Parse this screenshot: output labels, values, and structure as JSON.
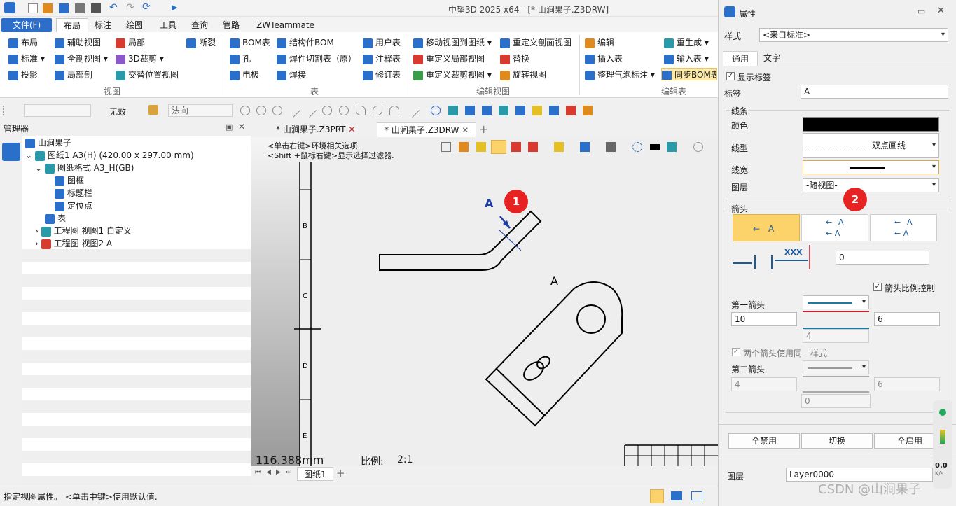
{
  "window": {
    "title": "中望3D 2025 x64 - [* 山涧果子.Z3DRW]"
  },
  "menu": {
    "tabs": [
      "文件(F)",
      "布局",
      "标注",
      "绘图",
      "工具",
      "查询",
      "管路",
      "ZWTeammate"
    ]
  },
  "ribbon": {
    "view": {
      "items": [
        "布局",
        "辅助视图",
        "局部",
        "断裂",
        "标准",
        "全剖视图",
        "3D裁剪",
        "投影",
        "局部剖",
        "交替位置视图"
      ],
      "label": "视图"
    },
    "table": {
      "items": [
        "BOM表",
        "结构件BOM",
        "用户表",
        "孔",
        "焊件切割表（原）",
        "注释表",
        "电极",
        "焊接",
        "修订表"
      ],
      "label": "表"
    },
    "editview": {
      "items": [
        "移动视图到图纸",
        "重定义剖面视图",
        "重定义局部视图",
        "替换",
        "重定义裁剪视图",
        "旋转视图"
      ],
      "label": "编辑视图"
    },
    "edittable": {
      "items": [
        "编辑",
        "重生成",
        "插入表",
        "输入表",
        "整理气泡标注",
        "同步BOM表"
      ],
      "label": "编辑表"
    }
  },
  "toolbar2": {
    "mode": "无效",
    "direction": "法向"
  },
  "manager": {
    "title": "管理器",
    "tree": [
      "山涧果子",
      "图纸1 A3(H) (420.00 x 297.00 mm)",
      "图纸格式 A3_H(GB)",
      "图框",
      "标题栏",
      "定位点",
      "表",
      "工程图 视图1 自定义",
      "工程图 视图2 A"
    ]
  },
  "doctabs": [
    "* 山涧果子.Z3PRT",
    "* 山涧果子.Z3DRW"
  ],
  "canvas": {
    "hint1": "<单击右键>环境相关选项.",
    "hint2": "<Shift +鼠标右键>显示选择过滤器.",
    "frame_labels": [
      "B",
      "C",
      "D",
      "E"
    ],
    "view_label": "A",
    "arrow_label": "A",
    "measure": "116.388mm",
    "scale_label": "比例:",
    "scale_value": "2:1"
  },
  "sheettab": "图纸1",
  "status": {
    "text": "指定视图属性。 <单击中键>使用默认值."
  },
  "badges": [
    "1",
    "2"
  ],
  "properties": {
    "title": "属性",
    "style_label": "样式",
    "style_value": "<来自标准>",
    "tabs": [
      "通用",
      "文字"
    ],
    "show_label": "显示标签",
    "tag_label": "标签",
    "tag_value": "A",
    "line_section": "线条",
    "color_label": "颜色",
    "color_value": "#000000",
    "linetype_label": "线型",
    "linetype_value": "双点画线",
    "linewidth_label": "线宽",
    "layer_label": "图层",
    "layer_value": "-随视图-",
    "arrow_section": "箭头",
    "arrow_buttons": [
      "A",
      "A",
      "A"
    ],
    "xxx_label": "XXX",
    "offset_value": "0",
    "ratio_label": "箭头比例控制",
    "first_label": "第一箭头",
    "first_len": "10",
    "first_width": "6",
    "first_mid": "4",
    "same_label": "两个箭头使用同一样式",
    "second_label": "第二箭头",
    "second_len": "4",
    "second_width": "6",
    "second_mid": "0",
    "buttons": [
      "全禁用",
      "切换",
      "全启用"
    ],
    "bottom_layer_label": "图层",
    "bottom_layer_value": "Layer0000",
    "gauge_value": "0.0",
    "gauge_unit": "K/s"
  },
  "watermark": "CSDN @山涧果子"
}
